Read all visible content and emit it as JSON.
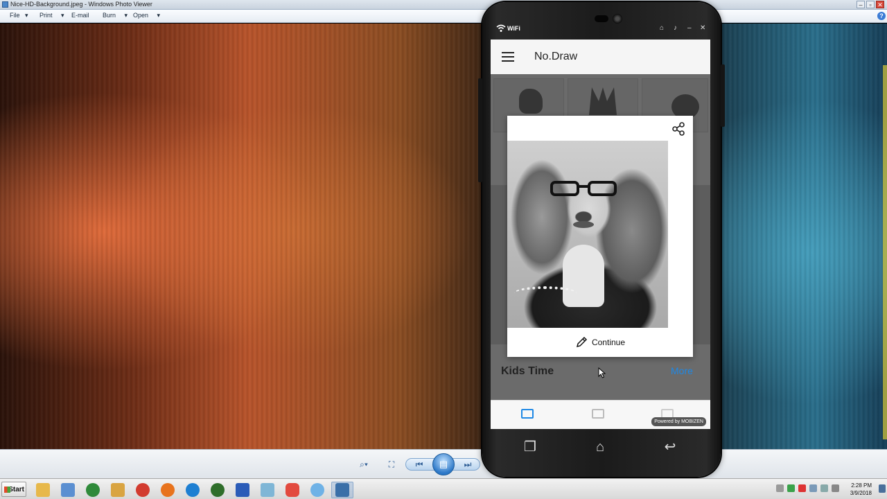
{
  "window": {
    "title": "Nice-HD-Background.jpeg - Windows Photo Viewer",
    "controls": [
      "–",
      "▫",
      "✕"
    ]
  },
  "menu": {
    "items": [
      {
        "label": "File",
        "x_note": ""
      },
      {
        "label": "Print"
      },
      {
        "label": "E-mail"
      },
      {
        "label": "Burn"
      },
      {
        "label": "Open"
      }
    ],
    "help_icon": "help-icon"
  },
  "phone": {
    "status": {
      "wifi_label": "WiFi",
      "icons": [
        "android-icon",
        "bell-icon",
        "minimize-icon",
        "close-icon"
      ]
    },
    "app": {
      "title": "No.Draw",
      "section_kids": "Kids Time",
      "more_label": "More",
      "powered_by": "Powered by MOBIZEN"
    },
    "dialog": {
      "continue_label": "Continue",
      "share_icon": "share-icon",
      "pencil_icon": "pencil-icon"
    },
    "nav_keys": [
      "recent-apps-icon",
      "home-icon",
      "back-icon"
    ]
  },
  "taskbar": {
    "start_label": "Start",
    "clock_time": "2:28 PM",
    "clock_date": "3/9/2018",
    "apps": [
      {
        "icon": "folder-icon",
        "color": "#e7b84a"
      },
      {
        "icon": "notepad-icon",
        "color": "#5b8fd1"
      },
      {
        "icon": "chrome-icon",
        "color": "#2f8a3a"
      },
      {
        "icon": "paint-icon",
        "color": "#d9a441"
      },
      {
        "icon": "redball-icon",
        "color": "#d23b2f"
      },
      {
        "icon": "firefox-icon",
        "color": "#e8731d"
      },
      {
        "icon": "ie-icon",
        "color": "#1e7fd2"
      },
      {
        "icon": "xbox-icon",
        "color": "#2f6e2b"
      },
      {
        "icon": "word-icon",
        "color": "#2b5cb8"
      },
      {
        "icon": "paper-icon",
        "color": "#7fb6d6"
      },
      {
        "icon": "mobizen-icon",
        "color": "#e24a3f"
      },
      {
        "icon": "circle-app-icon",
        "color": "#6fb2e6"
      },
      {
        "icon": "photo-viewer-icon",
        "color": "#3a6fa8"
      }
    ]
  },
  "colors": {
    "accent_blue": "#1e88e5",
    "mobizen_red": "#e24a3f"
  }
}
